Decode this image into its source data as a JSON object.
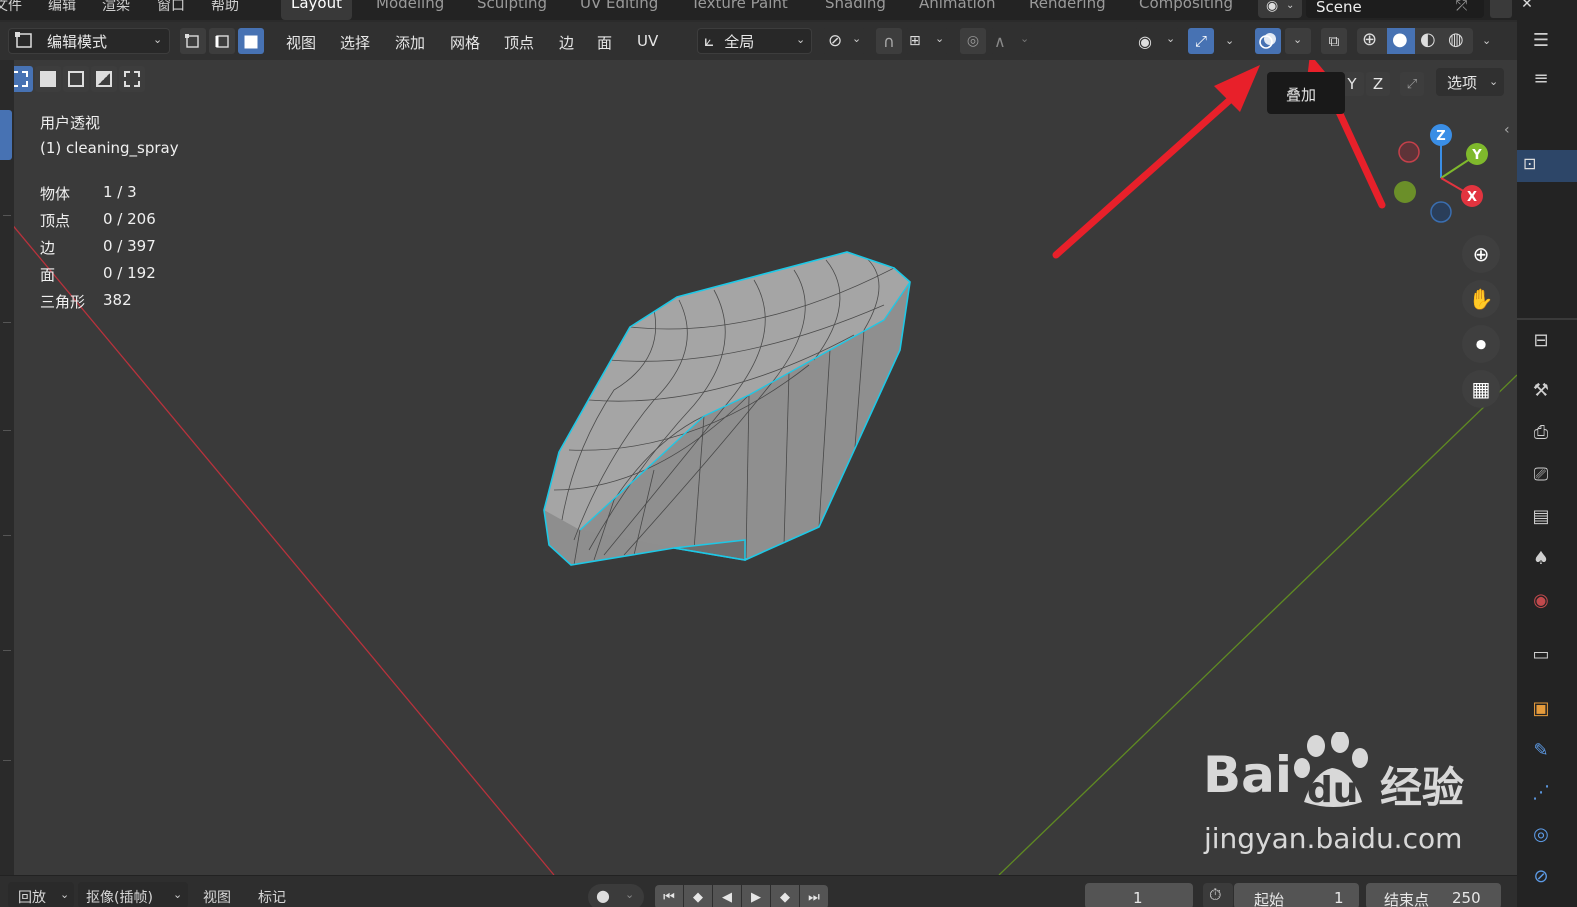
{
  "menubar": {
    "file": "文件",
    "edit": "编辑",
    "render": "渲染",
    "window": "窗口",
    "help": "帮助"
  },
  "workspaces": [
    "Layout",
    "Modeling",
    "Sculpting",
    "UV Editing",
    "Texture Paint",
    "Shading",
    "Animation",
    "Rendering",
    "Compositing"
  ],
  "active_workspace": "Layout",
  "scene_name": "Scene",
  "header": {
    "mode": "编辑模式",
    "menus": [
      "视图",
      "选择",
      "添加",
      "网格",
      "顶点",
      "边",
      "面",
      "UV"
    ],
    "transform_orientation": "全局"
  },
  "viewport": {
    "view_name": "用户透视",
    "object_name": "(1) cleaning_spray",
    "stats": [
      {
        "label": "物体",
        "value": "1 / 3"
      },
      {
        "label": "顶点",
        "value": "0 / 206"
      },
      {
        "label": "边",
        "value": "0 / 397"
      },
      {
        "label": "面",
        "value": "0 / 192"
      },
      {
        "label": "三角形",
        "value": "382"
      }
    ],
    "tooltip": "叠加",
    "axis_buttons": [
      "Y",
      "Z"
    ],
    "options_label": "选项",
    "gizmo_axes": {
      "x": "X",
      "y": "Y",
      "z": "Z"
    }
  },
  "timeline": {
    "playback": "回放",
    "keying": "抠像(插帧)",
    "view": "视图",
    "marker": "标记",
    "current_frame": "1",
    "start_label": "起始",
    "start_value": "1",
    "end_label": "结束点",
    "end_value": "250"
  },
  "watermark": {
    "brand": "Bai",
    "brand2": "du",
    "cn": "经验",
    "url": "jingyan.baidu.com"
  },
  "colors": {
    "accent": "#4772b3",
    "selection_outline": "#1ec8e6",
    "annotation_arrow": "#e8202a",
    "axis_x": "#e2343f",
    "axis_y": "#7fb92c",
    "axis_z": "#3a8ee6"
  }
}
